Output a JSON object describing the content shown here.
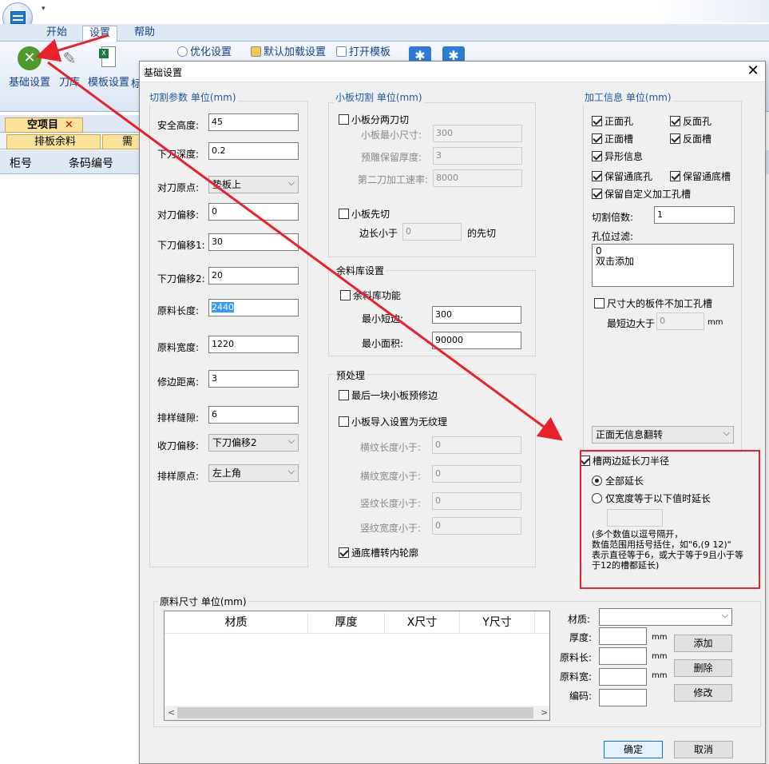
{
  "app": {
    "quick_access": "▾"
  },
  "menu": [
    "开始",
    "设置",
    "帮助"
  ],
  "ribbon": {
    "big_buttons": [
      "基础设置",
      "刀库",
      "模板设置",
      "标"
    ],
    "small_buttons": [
      "优化设置",
      "默认加载设置",
      "打开模板"
    ]
  },
  "left": {
    "tab": "空项目",
    "tab_close": "✕",
    "subtabs": [
      "排板余料",
      "需"
    ],
    "columns": [
      "柜号",
      "条码编号"
    ]
  },
  "dialog": {
    "title": "基础设置",
    "close": "✕",
    "cut_params": {
      "title": "切割参数 单位(mm)",
      "fields": [
        {
          "label": "安全高度:",
          "value": "45"
        },
        {
          "label": "下刀深度:",
          "value": "0.2"
        },
        {
          "label": "对刀原点:",
          "value": "垫板上"
        },
        {
          "label": "对刀偏移:",
          "value": "0"
        },
        {
          "label": "下刀偏移1:",
          "value": "30"
        },
        {
          "label": "下刀偏移2:",
          "value": "20"
        },
        {
          "label": "原料长度:",
          "value": "2440"
        },
        {
          "label": "原料宽度:",
          "value": "1220"
        },
        {
          "label": "修边距离:",
          "value": "3"
        },
        {
          "label": "排样缝隙:",
          "value": "6"
        },
        {
          "label": "收刀偏移:",
          "value": "下刀偏移2"
        },
        {
          "label": "排样原点:",
          "value": "左上角"
        }
      ]
    },
    "small_cut": {
      "title": "小板切割 单位(mm)",
      "two_cut": "小板分两刀切",
      "min_size_label": "小板最小尺寸:",
      "min_size": "300",
      "reserve_label": "预雕保留厚度:",
      "reserve": "3",
      "speed_label": "第二刀加工速率:",
      "speed": "8000",
      "first_cut": "小板先切",
      "edge_less": "边长小于",
      "edge_value": "0",
      "edge_suffix": "的先切"
    },
    "remnant": {
      "title": "余料库设置",
      "enable": "余料库功能",
      "min_short_label": "最小短边:",
      "min_short": "300",
      "min_area_label": "最小面积:",
      "min_area": "90000"
    },
    "preprocess": {
      "title": "预处理",
      "last_trim": "最后一块小板预修边",
      "no_grain": "小板导入设置为无纹理",
      "h_len_label": "横纹长度小于:",
      "h_len": "0",
      "h_wid_label": "横纹宽度小于:",
      "h_wid": "0",
      "v_len_label": "竖纹长度小于:",
      "v_len": "0",
      "v_wid_label": "竖纹宽度小于:",
      "v_wid": "0",
      "groove_contour": "通底槽转内轮廓"
    },
    "machining": {
      "title": "加工信息 单位(mm)",
      "front_hole": "正面孔",
      "back_hole": "反面孔",
      "front_groove": "正面槽",
      "back_groove": "反面槽",
      "shape_info": "异形信息",
      "keep_through_hole": "保留通底孔",
      "keep_through_groove": "保留通底槽",
      "keep_custom": "保留自定义加工孔槽",
      "multiple_label": "切割倍数:",
      "multiple": "1",
      "filter_label": "孔位过滤:",
      "filter_lines": [
        "0",
        "双击添加"
      ],
      "oversize": "尺寸大的板件不加工孔槽",
      "min_short_label": "最短边大于",
      "min_short": "0",
      "unit": "mm",
      "flip": "正面无信息翻转"
    },
    "groove_ext": {
      "title": "槽两边延长刀半径",
      "all": "全部延长",
      "width_only": "仅宽度等于以下值时延长",
      "value": "",
      "note": "(多个数值以逗号隔开，\n数值范围用括号括住，如\"6,(9 12)\"\n表示直径等于6，或大于等于9且小于等\n于12的槽都延长)"
    },
    "raw_size": {
      "title": "原料尺寸 单位(mm)",
      "columns": [
        "材质",
        "厚度",
        "X尺寸",
        "Y尺寸"
      ],
      "material_label": "材质:",
      "thick_label": "厚度:",
      "len_label": "原料长:",
      "wid_label": "原料宽:",
      "code_label": "编码:",
      "unit": "mm",
      "add": "添加",
      "delete": "删除",
      "modify": "修改",
      "scroll_left": "<",
      "scroll_right": ">"
    },
    "ok": "确定",
    "cancel": "取消"
  }
}
